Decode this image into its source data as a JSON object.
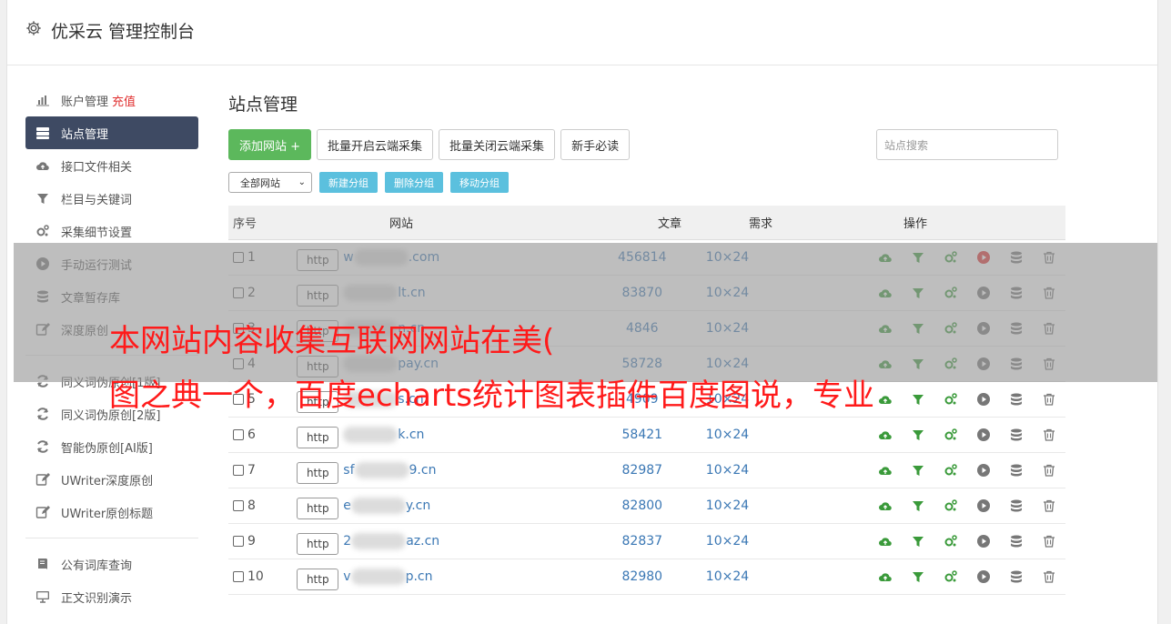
{
  "header": {
    "title": "优采云 管理控制台",
    "icon": "gear-icon"
  },
  "sidebar": {
    "items": [
      {
        "label": "账户管理",
        "extra": "充值",
        "icon": "bar-chart-icon",
        "active": false
      },
      {
        "label": "站点管理",
        "icon": "server-icon",
        "active": true
      },
      {
        "label": "接口文件相关",
        "icon": "cloud-upload-icon",
        "active": false
      },
      {
        "label": "栏目与关键词",
        "icon": "filter-icon",
        "active": false
      },
      {
        "label": "采集细节设置",
        "icon": "cogs-icon",
        "active": false
      },
      {
        "label": "手动运行测试",
        "icon": "play-icon",
        "active": false
      },
      {
        "label": "文章暂存库",
        "icon": "database-icon",
        "active": false
      },
      {
        "label": "深度原创",
        "icon": "edit-icon",
        "active": false
      }
    ],
    "items2": [
      {
        "label": "同义词伪原创[1版]",
        "icon": "refresh-icon"
      },
      {
        "label": "同义词伪原创[2版]",
        "icon": "refresh-icon"
      },
      {
        "label": "智能伪原创[AI版]",
        "icon": "refresh-icon"
      },
      {
        "label": "UWriter深度原创",
        "icon": "edit-icon"
      },
      {
        "label": "UWriter原创标题",
        "icon": "edit-icon"
      }
    ],
    "items3": [
      {
        "label": "公有词库查询",
        "icon": "book-icon"
      },
      {
        "label": "正文识别演示",
        "icon": "monitor-icon"
      }
    ]
  },
  "main": {
    "title": "站点管理",
    "buttons": {
      "add": "添加网站 +",
      "batch_on": "批量开启云端采集",
      "batch_off": "批量关闭云端采集",
      "newbie": "新手必读"
    },
    "search_placeholder": "站点搜索",
    "group_select": "全部网站",
    "group_buttons": {
      "new": "新建分组",
      "delete": "删除分组",
      "move": "移动分组"
    },
    "table": {
      "headers": {
        "no": "序号",
        "site": "网站",
        "articles": "文章",
        "demand": "需求",
        "ops": "操作"
      },
      "rows": [
        {
          "no": "1",
          "prefix": "http",
          "pre": "w",
          "domain": ".com",
          "articles": "456814",
          "demand": "10×24",
          "play_red": true
        },
        {
          "no": "2",
          "prefix": "http",
          "pre": "",
          "domain": "lt.cn",
          "articles": "83870",
          "demand": "10×24",
          "play_red": false
        },
        {
          "no": "3",
          "prefix": "http",
          "pre": "",
          "domain": "n.cn",
          "articles": "4846",
          "demand": "10×24",
          "play_red": false
        },
        {
          "no": "4",
          "prefix": "http",
          "pre": "",
          "domain": "pay.cn",
          "articles": "58728",
          "demand": "10×24",
          "play_red": false
        },
        {
          "no": "5",
          "prefix": "http",
          "pre": "",
          "domain": "s.cn",
          "articles": "4909",
          "demand": "10×24",
          "play_red": false
        },
        {
          "no": "6",
          "prefix": "http",
          "pre": "",
          "domain": "k.cn",
          "articles": "58421",
          "demand": "10×24",
          "play_red": false
        },
        {
          "no": "7",
          "prefix": "http",
          "pre": "sf",
          "domain": "9.cn",
          "articles": "82987",
          "demand": "10×24",
          "play_red": false
        },
        {
          "no": "8",
          "prefix": "http",
          "pre": "e",
          "domain": "y.cn",
          "articles": "82800",
          "demand": "10×24",
          "play_red": false
        },
        {
          "no": "9",
          "prefix": "http",
          "pre": "2",
          "domain": "az.cn",
          "articles": "82837",
          "demand": "10×24",
          "play_red": false
        },
        {
          "no": "10",
          "prefix": "http",
          "pre": "v",
          "domain": "p.cn",
          "articles": "82980",
          "demand": "10×24",
          "play_red": false
        }
      ]
    }
  },
  "watermark": {
    "line1": "本网站内容收集互联网网站在美(",
    "line2": "图之典一个，百度echarts统计图表插件百度图说，专业"
  },
  "colors": {
    "active_nav": "#3e4a63",
    "green": "#5cb85c",
    "info": "#5bc0de",
    "link": "#3a77b4",
    "red": "#e03030",
    "watermark": "#ff1a1a"
  }
}
